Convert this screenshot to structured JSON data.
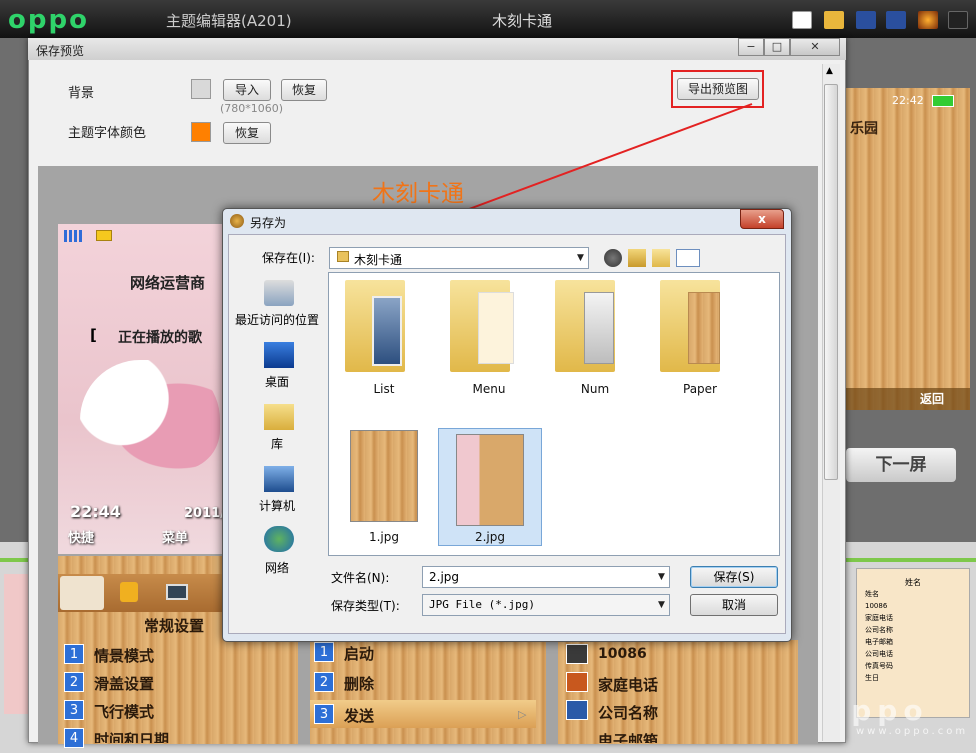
{
  "app": {
    "logo": "oppo",
    "title": "主题编辑器(A201)",
    "document_title": "木刻卡通"
  },
  "preview_window": {
    "title": "保存预览",
    "background_label": "背景",
    "import_button": "导入",
    "restore_button": "恢复",
    "size_hint": "(780*1060)",
    "font_color_label": "主题字体颜色",
    "font_restore_button": "恢复",
    "export_button": "导出预览图",
    "annotation": "木刻卡通"
  },
  "right_preview": {
    "time": "22:42",
    "title": "乐园",
    "back": "返回"
  },
  "next_button": "下一屏",
  "pink_phone": {
    "operator": "网络运营商",
    "playing": "正在播放的歌",
    "time": "22:44",
    "date": "2011/",
    "softkey_left": "快捷",
    "softkey_right": "菜单"
  },
  "settings_phone": {
    "title": "常规设置",
    "items": [
      {
        "n": "1",
        "label": "情景模式"
      },
      {
        "n": "2",
        "label": "滑盖设置"
      },
      {
        "n": "3",
        "label": "飞行模式"
      },
      {
        "n": "4",
        "label": "时间和日期"
      }
    ]
  },
  "menu_phone": {
    "items": [
      {
        "n": "1",
        "label": "启动"
      },
      {
        "n": "2",
        "label": "删除"
      },
      {
        "n": "3",
        "label": "发送"
      }
    ]
  },
  "contact_phone": {
    "items": [
      "10086",
      "家庭电话",
      "公司名称",
      "电子邮箱"
    ]
  },
  "thumb_right": {
    "title": "姓名",
    "items": [
      "姓名",
      "10086",
      "家庭电话",
      "公司名称",
      "电子邮箱",
      "公司电话",
      "传真号码",
      "生日"
    ]
  },
  "watermark": {
    "text": "oppo",
    "url": "www.oppo.com"
  },
  "save_dialog": {
    "title": "另存为",
    "save_in_label": "保存在(I):",
    "save_in_value": "木刻卡通",
    "places": [
      "最近访问的位置",
      "桌面",
      "库",
      "计算机",
      "网络"
    ],
    "files": [
      {
        "name": "List"
      },
      {
        "name": "Menu"
      },
      {
        "name": "Num"
      },
      {
        "name": "Paper"
      },
      {
        "name": "1.jpg"
      },
      {
        "name": "2.jpg"
      }
    ],
    "filename_label": "文件名(N):",
    "filename_value": "2.jpg",
    "filetype_label": "保存类型(T):",
    "filetype_value": "JPG File (*.jpg)",
    "save_button": "保存(S)",
    "cancel_button": "取消",
    "close": "x"
  },
  "colors": {
    "annotation": "#f07418",
    "highlight_box": "#e32222",
    "font_swatch": "#ff8000",
    "bg_swatch": "#d9d9d9"
  }
}
